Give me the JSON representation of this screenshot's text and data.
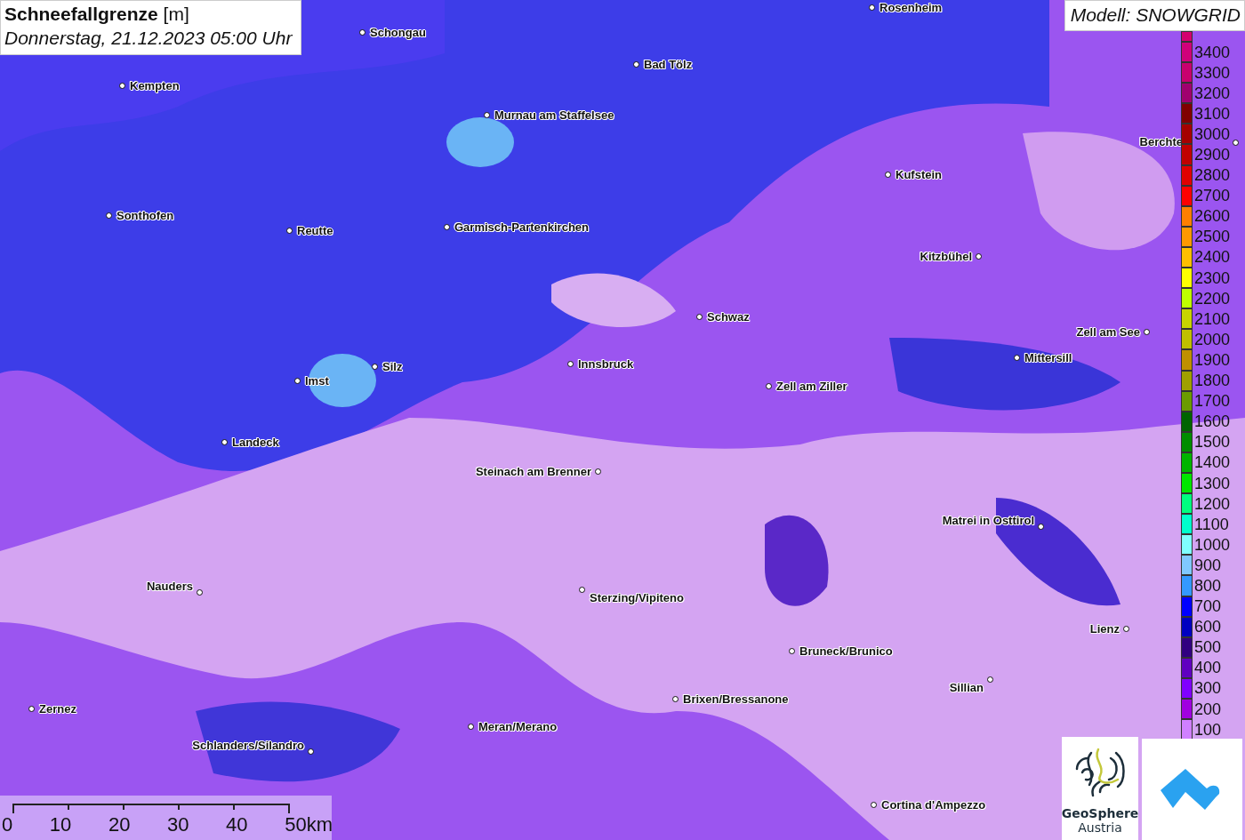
{
  "title": {
    "name": "Schneefallgrenze",
    "unit": "[m]",
    "datetime": "Donnerstag, 21.12.2023 05:00 Uhr"
  },
  "model_label": "Modell: SNOWGRID",
  "cities": [
    {
      "name": "Rosenheim"
    },
    {
      "name": "Schongau"
    },
    {
      "name": "Kempten"
    },
    {
      "name": "Bad Tölz"
    },
    {
      "name": "Murnau am Staffelsee"
    },
    {
      "name": "Berchte"
    },
    {
      "name": "Kufstein"
    },
    {
      "name": "Sonthofen"
    },
    {
      "name": "Reutte"
    },
    {
      "name": "Garmisch-Partenkirchen"
    },
    {
      "name": "Kitzbühel"
    },
    {
      "name": "Schwaz"
    },
    {
      "name": "Zell am See"
    },
    {
      "name": "Mittersill"
    },
    {
      "name": "Silz"
    },
    {
      "name": "Imst"
    },
    {
      "name": "Innsbruck"
    },
    {
      "name": "Zell am Ziller"
    },
    {
      "name": "Landeck"
    },
    {
      "name": "Steinach am Brenner"
    },
    {
      "name": "Matrei in Osttirol"
    },
    {
      "name": "Nauders"
    },
    {
      "name": "Sterzing/Vipiteno"
    },
    {
      "name": "Lienz"
    },
    {
      "name": "Bruneck/Brunico"
    },
    {
      "name": "Sillian"
    },
    {
      "name": "Brixen/Bressanone"
    },
    {
      "name": "Zernez"
    },
    {
      "name": "Meran/Merano"
    },
    {
      "name": "Schlanders/Silandro"
    },
    {
      "name": "Cortina d'Ampezzo"
    }
  ],
  "legend": [
    {
      "color": "#d4006f"
    },
    {
      "label": "3400",
      "color": "#d0007a"
    },
    {
      "label": "3300",
      "color": "#c8006e"
    },
    {
      "label": "3200",
      "color": "#a0006e"
    },
    {
      "label": "3100",
      "color": "#800000"
    },
    {
      "label": "3000",
      "color": "#a50000"
    },
    {
      "label": "2900",
      "color": "#c00000"
    },
    {
      "label": "2800",
      "color": "#e00000"
    },
    {
      "label": "2700",
      "color": "#ff0000"
    },
    {
      "label": "2600",
      "color": "#ff7f00"
    },
    {
      "label": "2500",
      "color": "#ff9900"
    },
    {
      "label": "2400",
      "color": "#ffbf00"
    },
    {
      "label": "2300",
      "color": "#ffff00"
    },
    {
      "label": "2200",
      "color": "#bfff00"
    },
    {
      "label": "2100",
      "color": "#c8d400"
    },
    {
      "label": "2000",
      "color": "#c0c000"
    },
    {
      "label": "1900",
      "color": "#c09000"
    },
    {
      "label": "1800",
      "color": "#a0a000"
    },
    {
      "label": "1700",
      "color": "#6b9b00"
    },
    {
      "label": "1600",
      "color": "#006400"
    },
    {
      "label": "1500",
      "color": "#008c00"
    },
    {
      "label": "1400",
      "color": "#00b400"
    },
    {
      "label": "1300",
      "color": "#00e600"
    },
    {
      "label": "1200",
      "color": "#00ff80"
    },
    {
      "label": "1100",
      "color": "#00ffcc"
    },
    {
      "label": "1000",
      "color": "#80ffff"
    },
    {
      "label": "900",
      "color": "#80c8ff"
    },
    {
      "label": "800",
      "color": "#3399ff"
    },
    {
      "label": "700",
      "color": "#0000ff"
    },
    {
      "label": "600",
      "color": "#0000c0"
    },
    {
      "label": "500",
      "color": "#300080"
    },
    {
      "label": "400",
      "color": "#6000c0"
    },
    {
      "label": "300",
      "color": "#8000ff"
    },
    {
      "label": "200",
      "color": "#a000e0"
    },
    {
      "label": "100",
      "color": "#d080ff"
    }
  ],
  "scale_bar": {
    "ticks": [
      "0",
      "10",
      "20",
      "30",
      "40",
      "50km"
    ]
  },
  "logos": {
    "geosphere_name": "GeoSphere",
    "geosphere_country": "Austria"
  }
}
